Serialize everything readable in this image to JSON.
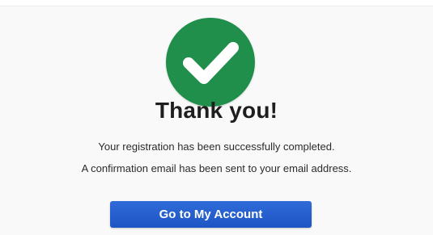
{
  "colors": {
    "success": "#1f8f4b",
    "primary_button": "#2560ce",
    "title_text": "#1e1e1e",
    "body_text": "#2b2b2b"
  },
  "icon": {
    "name": "checkmark-icon"
  },
  "confirmation": {
    "title": "Thank you!",
    "message_line1": "Your registration has been successfully completed.",
    "message_line2": "A confirmation email has been sent to your email address."
  },
  "actions": {
    "primary_label": "Go to My Account"
  }
}
